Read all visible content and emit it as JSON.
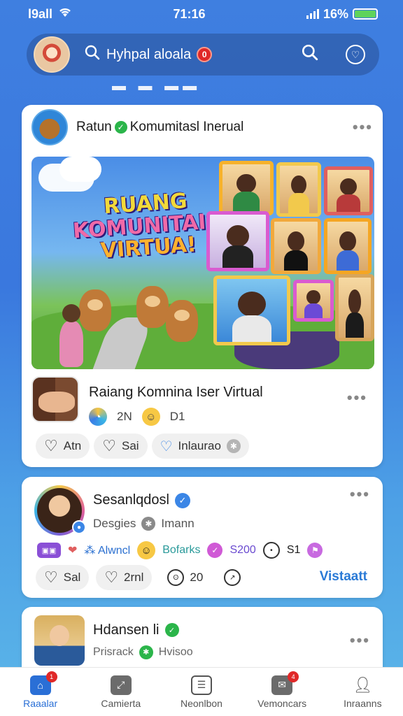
{
  "status_bar": {
    "carrier": "l9all",
    "time": "71:16",
    "battery_text": "16%"
  },
  "search": {
    "placeholder": "Hyhpal aloala",
    "notif_count": "0"
  },
  "card1": {
    "title": "Ratun",
    "title_suffix": "Komumitasl Inerual",
    "hero": {
      "line1": "RUANG",
      "line2": "KOMUNITAIS",
      "line3": "VIRTUA!"
    },
    "sub_title": "Raiang Komnina Iser Virtual",
    "stat1": "2N",
    "stat2": "D1",
    "actions": [
      {
        "label": "Atn"
      },
      {
        "label": "Sai"
      },
      {
        "label": "Inlaurao"
      }
    ]
  },
  "card2": {
    "name": "Sesanlqdosl",
    "sub": "Desgies",
    "sub2": "Imann",
    "tags": {
      "t1": "Alwncl",
      "t2": "Bofarks",
      "t3": "S200",
      "t4": "S1"
    },
    "actions": [
      {
        "label": "Sal"
      },
      {
        "label": "2rnl"
      },
      {
        "label": "20"
      }
    ],
    "visit": "Vistaatt"
  },
  "card3": {
    "name": "Hdansen li",
    "sub": "Prisrack",
    "sub2": "Hvisoo"
  },
  "nav": [
    {
      "label": "Raaalar",
      "badge": "1"
    },
    {
      "label": "Camierta"
    },
    {
      "label": "Neonlbon"
    },
    {
      "label": "Vemoncars",
      "badge": "4"
    },
    {
      "label": "Inraanns"
    }
  ],
  "colors": {
    "accent": "#2a6fd6",
    "verified_green": "#2bb54a",
    "badge_red": "#e02828"
  }
}
